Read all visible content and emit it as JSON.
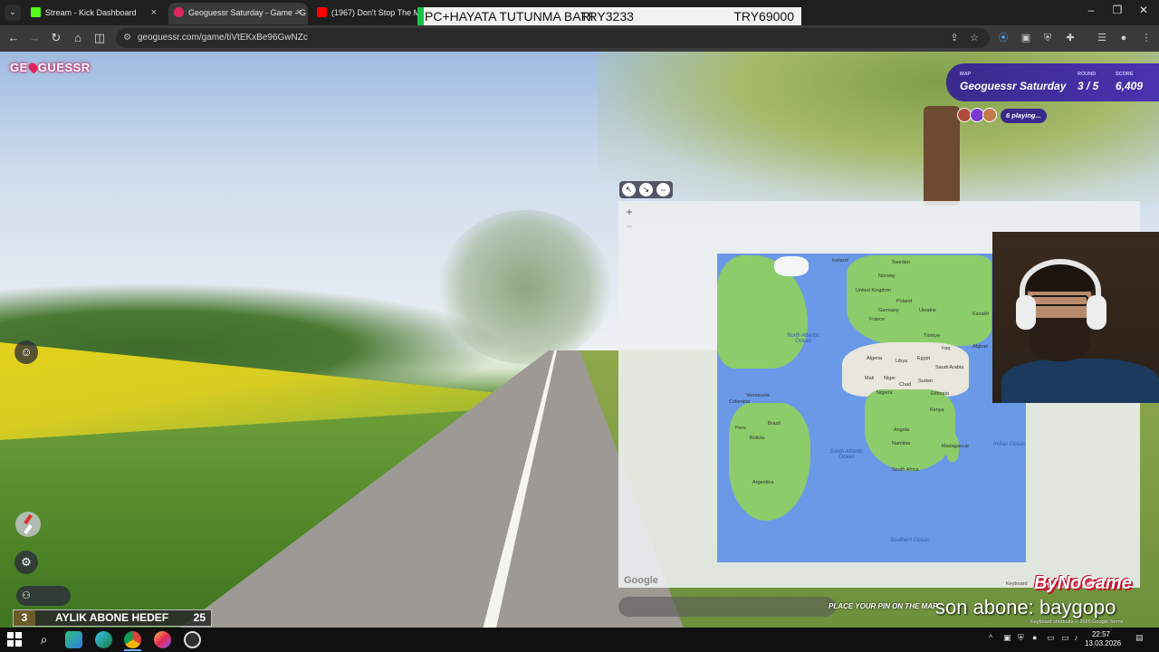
{
  "browser": {
    "tabs": [
      {
        "title": "Stream - Kick Dashboard",
        "active": false
      },
      {
        "title": "Geoguessr Saturday - Game - G",
        "active": true
      },
      {
        "title": "(1967) Don't Stop The Mus",
        "active": false
      }
    ],
    "tab_close": "×",
    "url": "geoguessr.com/game/tiVtEKxBe96GwNZc"
  },
  "obs_banner": {
    "title": "PC+HAYATA TUTUNMA BARI",
    "current": "TRY3233",
    "target": "TRY69000"
  },
  "game": {
    "logo_left": "GE",
    "logo_right": "GUESSR",
    "hud": {
      "map_label": "MAP",
      "map_value": "Geoguessr Saturday",
      "round_label": "ROUND",
      "round_value": "3 / 5",
      "score_label": "SCORE",
      "score_value": "6,409"
    },
    "players_text": "6 playing...",
    "map": {
      "zoom_in": "+",
      "zoom_out": "−",
      "google_logo": "Google",
      "keyboard_label": "Keyboard",
      "place_prompt": "PLACE YOUR PIN ON THE MAP",
      "attribution": "Keyboard shortcuts   © 2026 Google   Terms",
      "labels": {
        "iceland": "Iceland",
        "sweden": "Sweden",
        "norway": "Norway",
        "uk": "United Kingdom",
        "poland": "Poland",
        "germany": "Germany",
        "ukraine": "Ukraine",
        "france": "France",
        "kazakh": "Kazakh",
        "turkiye": "Türkiye",
        "iraq": "Iraq",
        "afghan": "Afghan",
        "algeria": "Algeria",
        "libya": "Libya",
        "egypt": "Egypt",
        "saudi": "Saudi Arabia",
        "mali": "Mali",
        "niger": "Niger",
        "chad": "Chad",
        "sudan": "Sudan",
        "nigeria": "Nigeria",
        "ethiopia": "Ethiopia",
        "kenya": "Kenya",
        "angola": "Angola",
        "madagascar": "Madagascar",
        "namibia": "Namibia",
        "south_africa": "South Africa",
        "venezuela": "Venezuela",
        "colombia": "Colombia",
        "peru": "Peru",
        "brazil": "Brazil",
        "bolivia": "Bolivia",
        "argentina": "Argentina",
        "north_atlantic": "North Atlantic Ocean",
        "south_atlantic": "South Atlantic Ocean",
        "indian": "Indian Ocean",
        "southern": "Southern Ocean"
      }
    }
  },
  "overlays": {
    "goal_count": "3",
    "goal_label": "AYLIK ABONE HEDEF",
    "goal_target": "25",
    "sponsor": "ByNoGame",
    "last_sub": "son abone: baygopo"
  },
  "taskbar": {
    "time": "22:57",
    "date": "13.03.2026"
  }
}
